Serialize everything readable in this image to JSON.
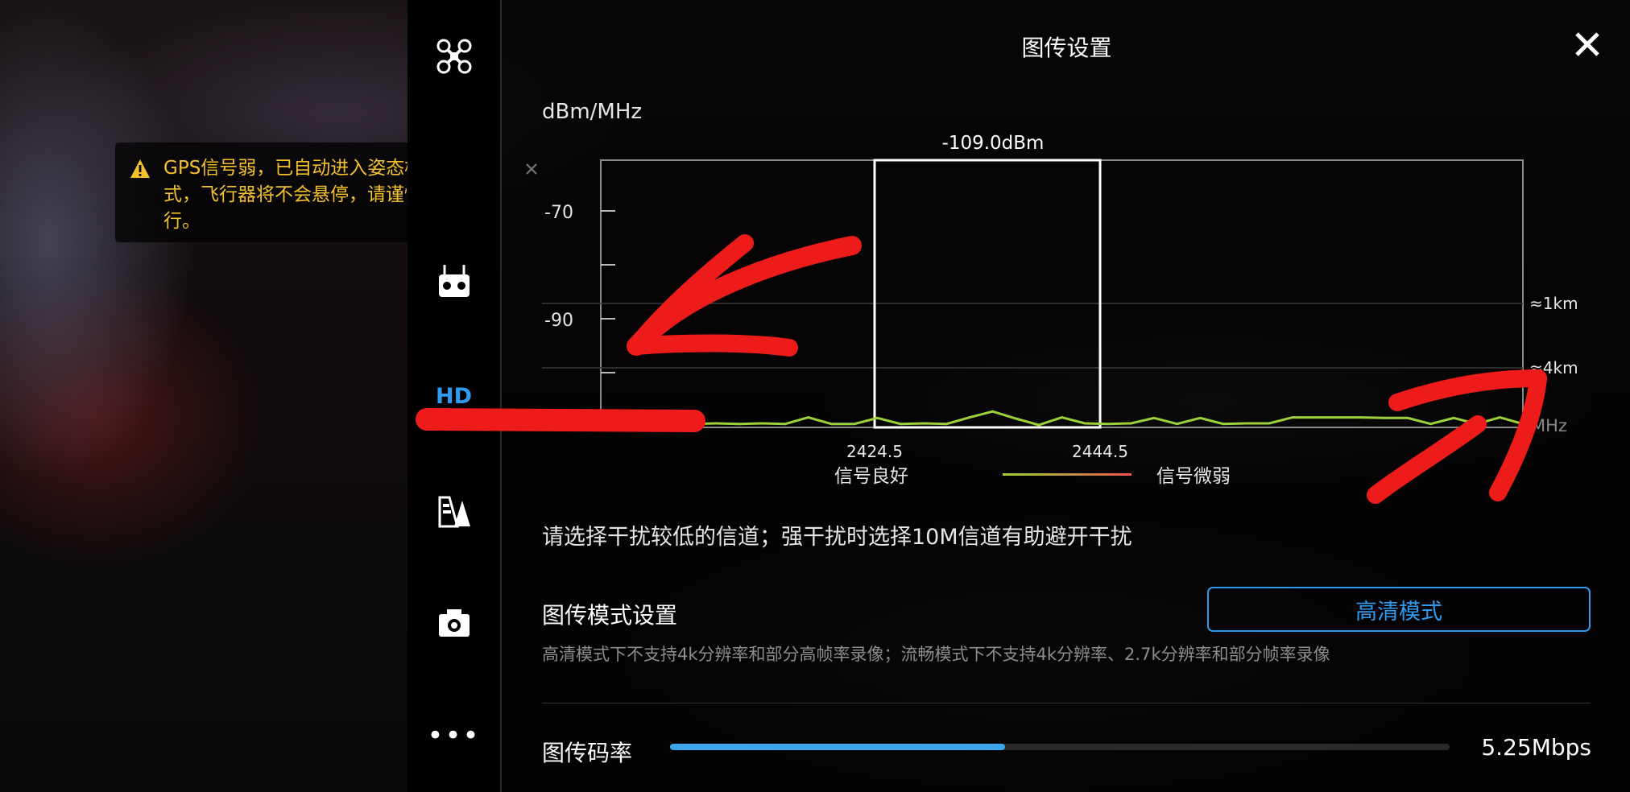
{
  "warning": {
    "text": "GPS信号弱，已自动进入姿态模式，飞行器将不会悬停，请谨慎飞行。",
    "color": "#f3c12c"
  },
  "sidebar": {
    "hd_label": "HD",
    "more_label": "•••",
    "accent_color": "#2e9bf0",
    "items": [
      "aircraft-icon",
      "remote-controller-icon",
      "hd-transmission",
      "battery-icon",
      "camera-icon",
      "more-icon"
    ]
  },
  "panel": {
    "title": "图传设置",
    "close_glyph": "✕"
  },
  "chart_data": {
    "type": "line",
    "ylabel": "dBm/MHz",
    "y_ticks": [
      "-70",
      "-90"
    ],
    "x_ticks": [
      "2424.5",
      "2444.5"
    ],
    "x_unit_partial": "MHz",
    "selected_channel_label": "-109.0dBm",
    "distance_labels": [
      "≈1km",
      "≈4km"
    ],
    "legend": {
      "good": "信号良好",
      "weak": "信号微弱"
    },
    "series": [
      {
        "values": [
          -109.5,
          -109.6,
          -109.5,
          -108.2,
          -109.5,
          -109.4,
          -109.5,
          -109.4,
          -109.5,
          -108.3,
          -109.5,
          -109.5,
          -108.4,
          -109.5,
          -109.4,
          -109.5,
          -108.3,
          -107.2,
          -108.5,
          -109.7,
          -108.3,
          -109.4,
          -109.5,
          -109.4,
          -108.4,
          -109.5,
          -108.4,
          -109.5,
          -109.4,
          -109.4,
          -108.3,
          -108.3,
          -108.3,
          -108.3,
          -108.4,
          -108.4,
          -109.5,
          -108.4,
          -109.5,
          -108.3,
          -109.5
        ]
      }
    ]
  },
  "hint": "请选择干扰较低的信道；强干扰时选择10M信道有助避开干扰",
  "mode": {
    "label": "图传模式设置",
    "button": "高清模式",
    "description": "高清模式下不支持4k分辨率和部分高帧率录像；流畅模式下不支持4k分辨率、2.7k分辨率和部分帧率录像"
  },
  "bitrate": {
    "label": "图传码率",
    "value": "5.25Mbps",
    "fill_fraction": 0.43
  }
}
